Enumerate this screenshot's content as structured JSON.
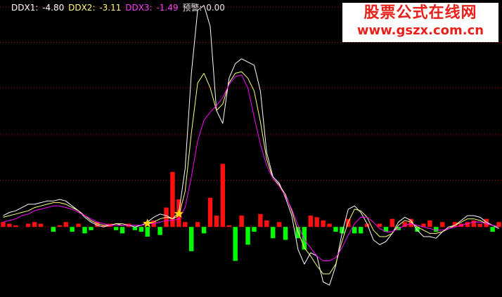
{
  "legend": {
    "ddx1_name": "DDX1:",
    "ddx1_value": "-4.80",
    "ddx2_name": "DDX2:",
    "ddx2_value": "-3.11",
    "ddx3_name": "DDX3:",
    "ddx3_value": "-1.49",
    "alert_name": "预警:",
    "alert_value": "0.00"
  },
  "watermark": {
    "title": "股票公式在线网",
    "url": "www.gszx.com.cn"
  },
  "colors": {
    "background": "#000000",
    "ddx1": "#ffffff",
    "ddx2": "#ffff80",
    "ddx3": "#ff00ff",
    "bar_up": "#ff1010",
    "bar_down": "#00ff00",
    "grid": "#aa0000",
    "marker": "#ffd800",
    "watermark": "#e8201a"
  },
  "chart_data": {
    "type": "line",
    "grid": true,
    "ylim": [
      -3.9,
      13.6
    ],
    "x_count": 80,
    "series": [
      {
        "name": "DDX1",
        "values": [
          0.7,
          0.9,
          1.0,
          1.2,
          1.4,
          1.4,
          1.5,
          1.6,
          1.6,
          1.7,
          1.6,
          1.3,
          1.0,
          0.6,
          0.3,
          0.1,
          0.0,
          0.1,
          0.2,
          0.1,
          0.1,
          0.0,
          0.1,
          0.3,
          0.6,
          0.8,
          0.7,
          0.5,
          0.9,
          3.6,
          9.5,
          13.4,
          13.7,
          12.4,
          7.2,
          6.4,
          9.2,
          10.1,
          10.4,
          10.2,
          10.0,
          8.4,
          4.6,
          3.1,
          2.7,
          1.8,
          0.7,
          -1.4,
          -2.3,
          -1.6,
          -1.8,
          -3.4,
          -3.6,
          -2.4,
          -0.4,
          1.1,
          1.3,
          0.9,
          0.2,
          -0.8,
          -1.1,
          -0.9,
          -0.4,
          0.3,
          0.6,
          0.4,
          -0.2,
          -0.6,
          -0.6,
          -0.7,
          -0.3,
          0.0,
          0.1,
          0.4,
          0.7,
          0.7,
          0.6,
          0.3,
          0.1,
          -0.1
        ]
      },
      {
        "name": "DDX2",
        "values": [
          0.6,
          0.7,
          0.8,
          0.9,
          1.0,
          1.2,
          1.3,
          1.4,
          1.5,
          1.5,
          1.4,
          1.2,
          1.0,
          0.7,
          0.4,
          0.2,
          0.1,
          0.1,
          0.2,
          0.2,
          0.1,
          0.1,
          0.1,
          0.2,
          0.3,
          0.5,
          0.6,
          0.5,
          0.7,
          2.2,
          5.8,
          8.9,
          9.5,
          8.6,
          7.2,
          7.6,
          8.9,
          9.5,
          9.6,
          9.2,
          8.4,
          6.5,
          4.2,
          3.0,
          2.6,
          2.0,
          1.0,
          -0.3,
          -1.3,
          -1.8,
          -2.4,
          -2.9,
          -2.9,
          -2.3,
          -0.9,
          0.3,
          1.1,
          1.0,
          0.6,
          -0.2,
          -0.6,
          -0.6,
          -0.4,
          0.1,
          0.4,
          0.3,
          0.0,
          -0.2,
          -0.4,
          -0.4,
          -0.3,
          -0.1,
          0.1,
          0.3,
          0.5,
          0.5,
          0.4,
          0.2,
          0.1,
          0.0
        ]
      },
      {
        "name": "DDX3",
        "values": [
          0.3,
          0.4,
          0.5,
          0.7,
          0.8,
          1.0,
          1.1,
          1.2,
          1.3,
          1.3,
          1.2,
          1.1,
          0.9,
          0.7,
          0.5,
          0.3,
          0.2,
          0.1,
          0.1,
          0.1,
          0.1,
          0.1,
          0.1,
          0.2,
          0.2,
          0.3,
          0.4,
          0.4,
          0.5,
          1.2,
          3.1,
          5.3,
          6.6,
          7.1,
          7.5,
          8.0,
          8.8,
          9.3,
          9.4,
          8.6,
          6.8,
          5.1,
          3.8,
          3.0,
          2.5,
          1.9,
          1.1,
          0.1,
          -0.8,
          -1.3,
          -1.8,
          -2.1,
          -2.1,
          -1.9,
          -1.3,
          -0.5,
          0.2,
          0.6,
          0.6,
          0.3,
          -0.1,
          -0.3,
          -0.3,
          -0.1,
          0.1,
          0.2,
          0.1,
          0.0,
          -0.1,
          -0.2,
          -0.2,
          -0.1,
          0.0,
          0.1,
          0.2,
          0.3,
          0.3,
          0.2,
          0.1,
          0.0
        ]
      },
      {
        "name": "DDX-bars",
        "values": [
          0.3,
          0.2,
          0.1,
          0,
          0.2,
          0.3,
          0.2,
          0,
          -0.3,
          0.1,
          0.3,
          -0.3,
          0.2,
          -0.4,
          -0.2,
          0.3,
          0.1,
          0.2,
          -0.2,
          -0.4,
          0.2,
          -0.2,
          -0.3,
          -0.6,
          0.4,
          -0.5,
          1.2,
          3.4,
          1.7,
          0.3,
          -1.5,
          0.3,
          -0.4,
          1.8,
          0.7,
          3.9,
          0.1,
          -2.1,
          0.7,
          -1.1,
          -0.3,
          0.8,
          0.4,
          -0.7,
          0.3,
          -0.8,
          0,
          -0.7,
          -1.4,
          0.7,
          0.6,
          0.4,
          0.2,
          -0.3,
          -0.4,
          0.5,
          -0.4,
          -0.4,
          0.2,
          0,
          0.2,
          -0.3,
          0.5,
          -0.2,
          0.3,
          0.5,
          -0.3,
          0.2,
          0.4,
          -0.3,
          0.3,
          0,
          0.3,
          0.2,
          0.3,
          0.4,
          0.2,
          0.5,
          -0.3,
          0.3
        ]
      }
    ],
    "markers": [
      {
        "type": "star",
        "x_index": 23
      },
      {
        "type": "star",
        "x_index": 28
      }
    ]
  }
}
